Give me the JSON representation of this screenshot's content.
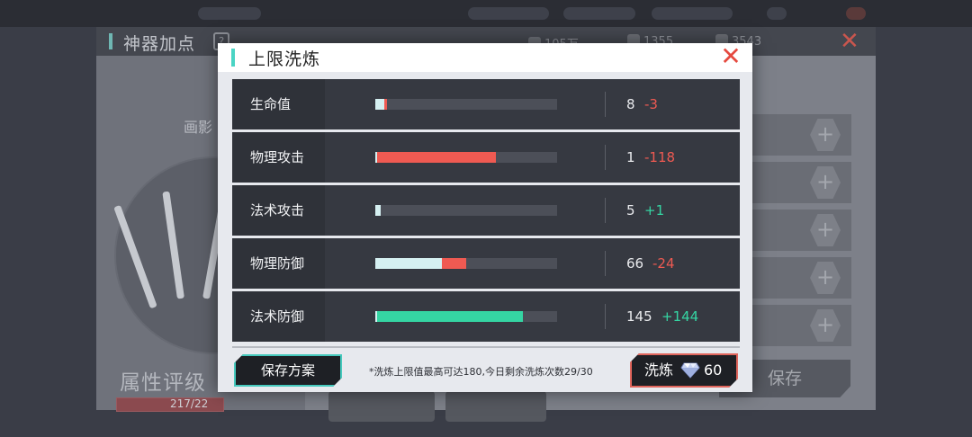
{
  "background": {
    "window_title": "神器加点",
    "help_icon": "?",
    "currencies": [
      {
        "icon": "coin-icon",
        "value": "105万"
      },
      {
        "icon": "stamina-icon",
        "value": "1355"
      },
      {
        "icon": "diamond-icon",
        "value": "3543"
      }
    ],
    "close_label": "✕",
    "sub_label": "画影",
    "rating_label": "属性评级",
    "rating_value": "217/22",
    "plus_symbol": "+",
    "save_label": "保存"
  },
  "modal": {
    "title": "上限洗炼",
    "close_label": "✕",
    "stats": [
      {
        "name": "生命值",
        "value": "8",
        "delta": "-3",
        "delta_sign": "neg",
        "base_fraction": 0.05,
        "change_fraction": 0.015
      },
      {
        "name": "物理攻击",
        "value": "1",
        "delta": "-118",
        "delta_sign": "neg",
        "base_fraction": 0.005,
        "change_fraction": 0.655
      },
      {
        "name": "法术攻击",
        "value": "5",
        "delta": "+1",
        "delta_sign": "pos",
        "base_fraction": 0.03,
        "change_fraction": 0.0
      },
      {
        "name": "物理防御",
        "value": "66",
        "delta": "-24",
        "delta_sign": "neg",
        "base_fraction": 0.365,
        "change_fraction": 0.135
      },
      {
        "name": "法术防御",
        "value": "145",
        "delta": "+144",
        "delta_sign": "pos",
        "base_fraction": 0.005,
        "change_fraction": 0.8
      }
    ],
    "save_plan_label": "保存方案",
    "notice": "*洗炼上限值最高可达180,今日剩余洗炼次数29/30",
    "wash_label": "洗炼",
    "wash_cost": "60",
    "colors": {
      "base_bar": "#d5f0f1",
      "negative": "#ef5a52",
      "positive": "#35d5a3",
      "accent": "#4ad4c4"
    }
  }
}
